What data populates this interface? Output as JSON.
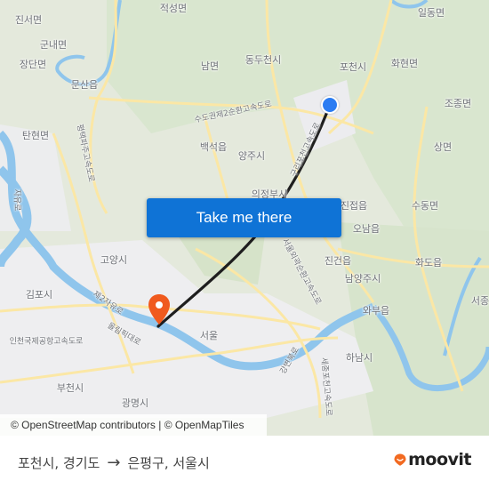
{
  "map": {
    "origin_name": "포천시",
    "destination_name": "은평구",
    "route_color": "#1e1e1e",
    "origin_marker_color": "#2b7cf2",
    "destination_marker_color": "#f05a1e",
    "labels": [
      {
        "text": "적성면",
        "name": "label-jeokseong"
      },
      {
        "text": "진서면",
        "name": "label-jinseo"
      },
      {
        "text": "군내면",
        "name": "label-gunnae"
      },
      {
        "text": "장단면",
        "name": "label-jangdan"
      },
      {
        "text": "문산읍",
        "name": "label-munsan"
      },
      {
        "text": "남면",
        "name": "label-nam"
      },
      {
        "text": "동두천시",
        "name": "label-dongducheon"
      },
      {
        "text": "포천시",
        "name": "label-pocheon"
      },
      {
        "text": "일동면",
        "name": "label-ildong"
      },
      {
        "text": "화현면",
        "name": "label-hwahyeon"
      },
      {
        "text": "조종면",
        "name": "label-jojong"
      },
      {
        "text": "탄현면",
        "name": "label-tanhyeon"
      },
      {
        "text": "백석읍",
        "name": "label-baekseok"
      },
      {
        "text": "양주시",
        "name": "label-yangju"
      },
      {
        "text": "상면",
        "name": "label-sang"
      },
      {
        "text": "의정부시",
        "name": "label-uijeongbu"
      },
      {
        "text": "진접읍",
        "name": "label-jinjeop"
      },
      {
        "text": "수동면",
        "name": "label-sudong"
      },
      {
        "text": "오남읍",
        "name": "label-onam"
      },
      {
        "text": "고양시",
        "name": "label-goyang"
      },
      {
        "text": "진건읍",
        "name": "label-jingeon"
      },
      {
        "text": "화도읍",
        "name": "label-hwado"
      },
      {
        "text": "남양주시",
        "name": "label-namyangju"
      },
      {
        "text": "김포시",
        "name": "label-gimpo"
      },
      {
        "text": "와부읍",
        "name": "label-wabu"
      },
      {
        "text": "서종",
        "name": "label-seojong"
      },
      {
        "text": "서울",
        "name": "label-seoul"
      },
      {
        "text": "하남시",
        "name": "label-hanam"
      },
      {
        "text": "부천시",
        "name": "label-bucheon"
      },
      {
        "text": "광명시",
        "name": "label-gwangmyeong"
      },
      {
        "text": "인천국제공항고속도로",
        "name": "label-incheon-airport-expwy"
      },
      {
        "text": "수도권제2순환고속도로",
        "name": "label-capital-ring2-expwy"
      },
      {
        "text": "평택파주고속도로",
        "name": "label-pyeongtaek-paju-expwy"
      },
      {
        "text": "자유로",
        "name": "label-jayuro"
      },
      {
        "text": "제2자유로",
        "name": "label-jayuro2"
      },
      {
        "text": "올림픽대로",
        "name": "label-olympic-daero"
      },
      {
        "text": "세종포천고속도로",
        "name": "label-sejong-pocheon-expwy"
      },
      {
        "text": "서울외곽순환고속도로",
        "name": "label-seoul-ring-expwy"
      },
      {
        "text": "구리포천고속도로",
        "name": "label-guri-pocheon-expwy"
      },
      {
        "text": "강변북로",
        "name": "label-gangbyeon-bukro"
      }
    ]
  },
  "cta": {
    "label": "Take me there"
  },
  "attribution": {
    "text": "© OpenStreetMap contributors | © OpenMapTiles"
  },
  "footer": {
    "origin": "포천시, 경기도",
    "arrow": "→",
    "destination": "은평구, 서울시",
    "logo_text": "moovit",
    "logo_color": "#f26a21"
  }
}
